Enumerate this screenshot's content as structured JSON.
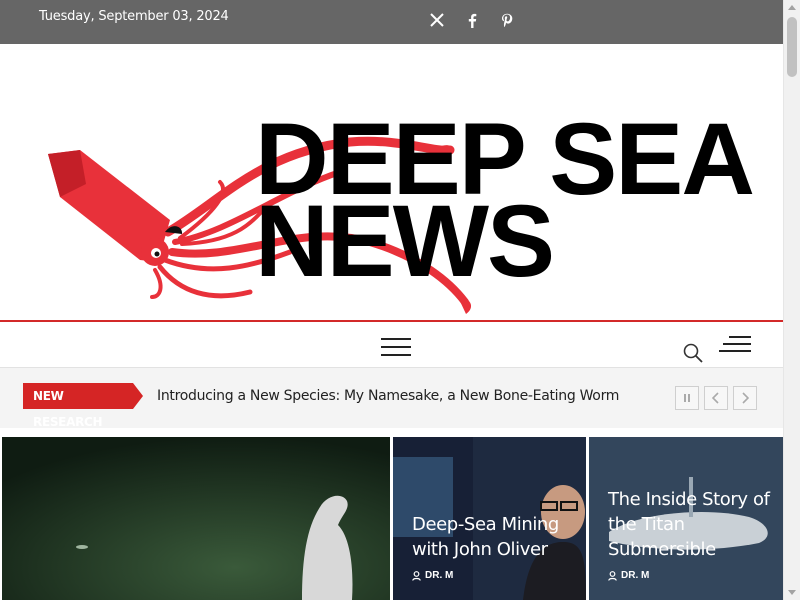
{
  "topbar": {
    "date": "Tuesday, September 03, 2024",
    "social": [
      {
        "icon": "x-twitter-icon"
      },
      {
        "icon": "facebook-icon"
      },
      {
        "icon": "pinterest-icon"
      }
    ]
  },
  "logo": {
    "line1": "DEEP SEA",
    "line2": "NEWS",
    "accent_color": "#e8313a"
  },
  "ticker": {
    "label": "NEW RESEARCH",
    "headline": "Introducing a New Species: My Namesake, a New Bone-Eating Worm",
    "controls": [
      "pause-icon",
      "chevron-left-icon",
      "chevron-right-icon"
    ]
  },
  "features": [
    {
      "title": "",
      "author": ""
    },
    {
      "title": "Deep-Sea Mining with John Oliver",
      "author": "DR. M"
    },
    {
      "title": "The Inside Story of the Titan Submersible",
      "author": "DR. M"
    }
  ],
  "colors": {
    "topbar": "#666666",
    "accent_red": "#d52525"
  }
}
